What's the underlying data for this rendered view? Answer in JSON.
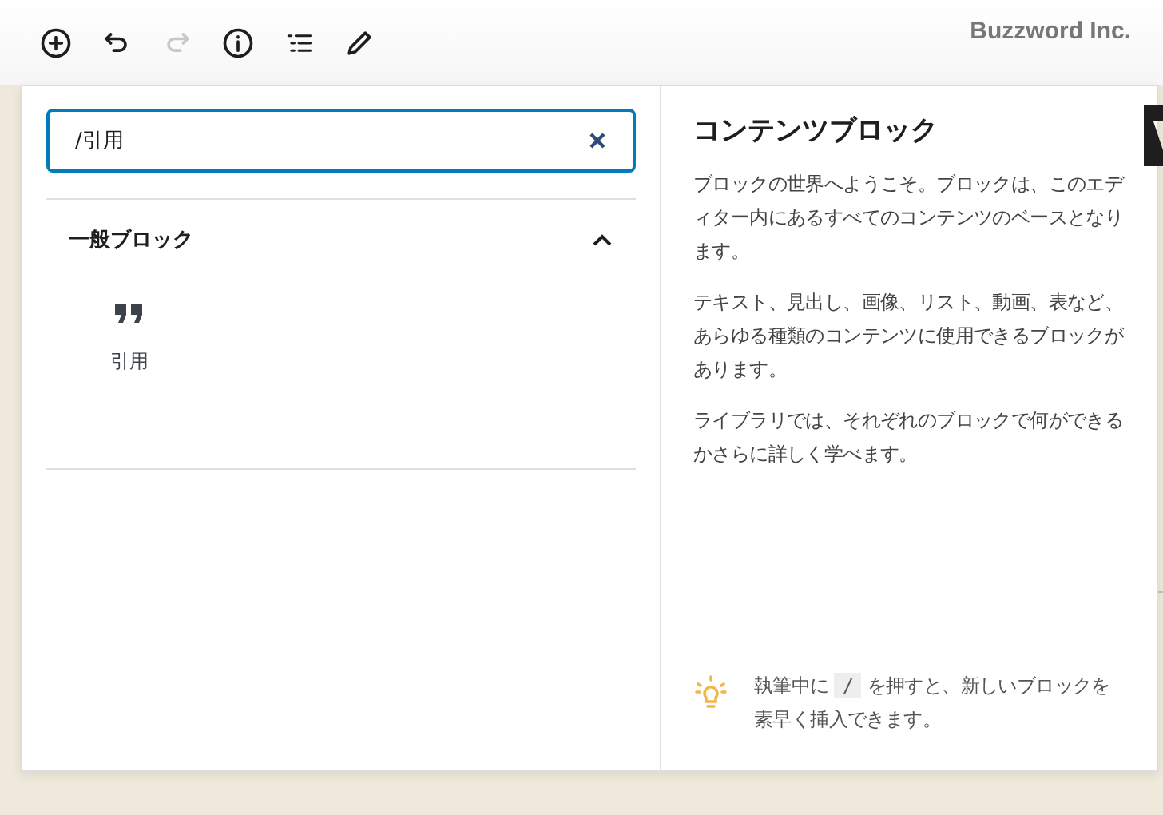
{
  "toolbar": {
    "tools": [
      {
        "kind": "add",
        "disabled": false
      },
      {
        "kind": "undo",
        "disabled": false
      },
      {
        "kind": "redo",
        "disabled": true
      },
      {
        "kind": "info",
        "disabled": false
      },
      {
        "kind": "outline",
        "disabled": false
      },
      {
        "kind": "edit",
        "disabled": false
      }
    ],
    "site_title": "Buzzword Inc."
  },
  "inserter": {
    "search": {
      "value": "/引用"
    },
    "category": {
      "title": "一般ブロック",
      "expanded": true,
      "blocks": [
        {
          "label": "引用",
          "kind": "quote"
        }
      ]
    }
  },
  "preview": {
    "title": "コンテンツブロック",
    "paragraphs": [
      "ブロックの世界へようこそ。ブロックは、このエディター内にあるすべてのコンテンツのベースとなります。",
      "テキスト、見出し、画像、リスト、動画、表など、あらゆる種類のコンテンツに使用できるブロックがあります。",
      "ライブラリでは、それぞれのブロックで何ができるかさらに詳しく学べます。"
    ],
    "tip": {
      "before": "執筆中に",
      "key": "/",
      "after": "を押すと、新しいブロックを素早く挿入できます。"
    }
  }
}
